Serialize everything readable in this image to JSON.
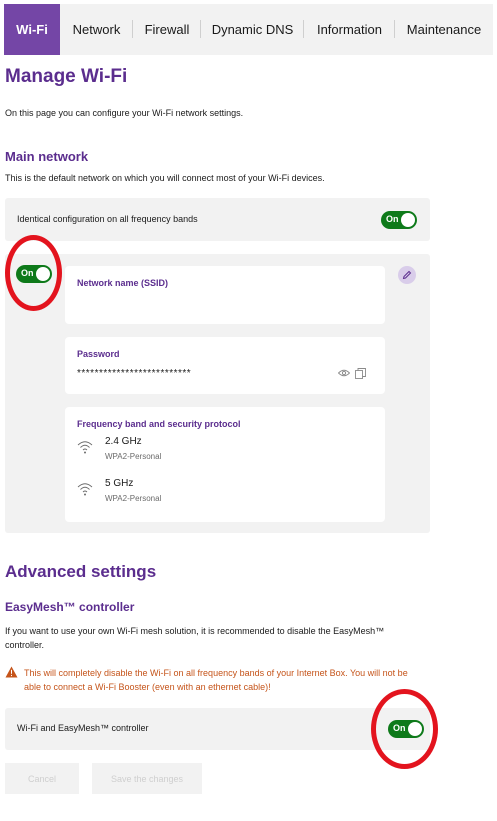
{
  "tabs": [
    {
      "label": "Wi-Fi",
      "active": true
    },
    {
      "label": "Network"
    },
    {
      "label": "Firewall"
    },
    {
      "label": "Dynamic DNS"
    },
    {
      "label": "Information"
    },
    {
      "label": "Maintenance"
    }
  ],
  "page": {
    "title": "Manage Wi-Fi",
    "intro": "On this page you can configure your Wi-Fi network settings."
  },
  "main_network": {
    "title": "Main network",
    "description": "This is the default network on which you will connect most of your Wi-Fi devices.",
    "identical_label": "Identical configuration on all frequency bands",
    "identical_toggle": "On",
    "network_toggle": "On",
    "ssid_label": "Network name (SSID)",
    "ssid_value": "",
    "password_label": "Password",
    "password_value": "**************************",
    "freq_label": "Frequency band and security protocol",
    "bands": [
      {
        "band": "2.4 GHz",
        "security": "WPA2-Personal"
      },
      {
        "band": "5 GHz",
        "security": "WPA2-Personal"
      }
    ]
  },
  "advanced": {
    "title": "Advanced settings",
    "easymesh_title": "EasyMesh™ controller",
    "easymesh_desc": "If you want to use your own Wi-Fi mesh solution, it is recommended to disable the EasyMesh™ controller.",
    "warning": "This will completely disable the Wi-Fi on all frequency bands of your Internet Box. You will not be able to connect a Wi-Fi Booster (even with an ethernet cable)!",
    "wifi_easymesh_label": "Wi-Fi and EasyMesh™ controller",
    "wifi_easymesh_toggle": "On"
  },
  "buttons": {
    "cancel": "Cancel",
    "save": "Save the changes"
  },
  "colors": {
    "accent": "#7446a6",
    "heading": "#5b2d8e",
    "toggle_on": "#0e7a1a",
    "warning": "#c5541a",
    "annotation_ring": "#e3141e"
  },
  "icons": [
    "wifi-icon",
    "pencil-icon",
    "eye-icon",
    "copy-icon",
    "warning-icon"
  ]
}
